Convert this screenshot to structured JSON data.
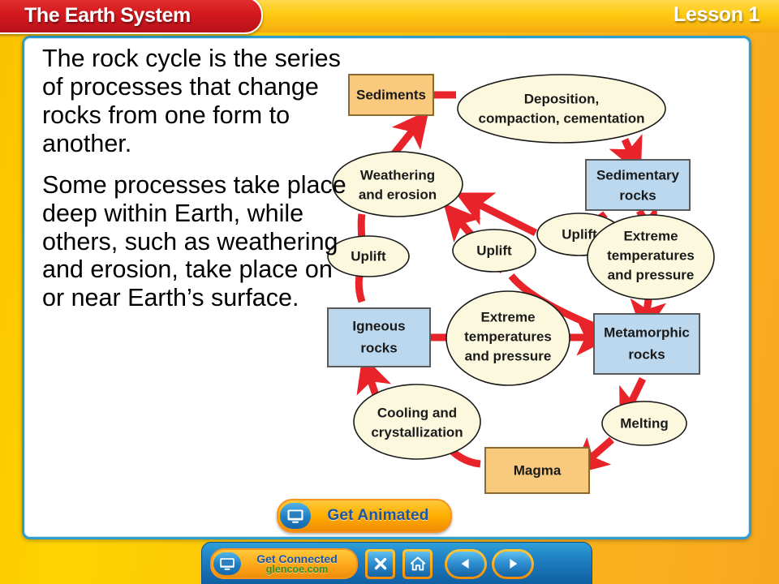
{
  "header": {
    "title": "The Earth System",
    "lesson": "Lesson 1"
  },
  "body": {
    "paragraph1": "The rock cycle is the series of processes that change rocks from one form to another.",
    "paragraph2": "Some processes take place deep within Earth, while others, such as weathering and erosion, take place on or near Earth’s surface."
  },
  "diagram": {
    "title": "Rock cycle diagram",
    "nodes": [
      {
        "id": "sediments",
        "label": "Sediments",
        "shape": "rect",
        "kind": "material",
        "color": "#f7c濃"
      },
      {
        "id": "deposition",
        "label": "Deposition, compaction, cementation",
        "shape": "ellipse",
        "kind": "process"
      },
      {
        "id": "sedimentary",
        "label": "Sedimentary rocks",
        "shape": "rect",
        "kind": "rock"
      },
      {
        "id": "weathering",
        "label": "Weathering and erosion",
        "shape": "ellipse",
        "kind": "process"
      },
      {
        "id": "uplift-left",
        "label": "Uplift",
        "shape": "ellipse",
        "kind": "process"
      },
      {
        "id": "uplift-mid",
        "label": "Uplift",
        "shape": "ellipse",
        "kind": "process"
      },
      {
        "id": "uplift-right",
        "label": "Uplift",
        "shape": "ellipse",
        "kind": "process"
      },
      {
        "id": "extreme-right",
        "label": "Extreme temperatures and pressure",
        "shape": "ellipse",
        "kind": "process"
      },
      {
        "id": "igneous",
        "label": "Igneous rocks",
        "shape": "rect",
        "kind": "rock"
      },
      {
        "id": "extreme-mid",
        "label": "Extreme temperatures and pressure",
        "shape": "ellipse",
        "kind": "process"
      },
      {
        "id": "metamorphic",
        "label": "Metamorphic rocks",
        "shape": "rect",
        "kind": "rock"
      },
      {
        "id": "cooling",
        "label": "Cooling and crystallization",
        "shape": "ellipse",
        "kind": "process"
      },
      {
        "id": "magma",
        "label": "Magma",
        "shape": "rect",
        "kind": "material"
      },
      {
        "id": "melting",
        "label": "Melting",
        "shape": "ellipse",
        "kind": "process"
      }
    ],
    "labels": {
      "sediments": "Sediments",
      "deposition_line1": "Deposition,",
      "deposition_line2": "compaction, cementation",
      "sedimentary_line1": "Sedimentary",
      "sedimentary_line2": "rocks",
      "weathering_line1": "Weathering",
      "weathering_line2": "and erosion",
      "uplift_left": "Uplift",
      "uplift_mid": "Uplift",
      "uplift_right": "Uplift",
      "extreme_right_line1": "Extreme",
      "extreme_right_line2": "temperatures",
      "extreme_right_line3": "and pressure",
      "igneous_line1": "Igneous",
      "igneous_line2": "rocks",
      "extreme_mid_line1": "Extreme",
      "extreme_mid_line2": "temperatures",
      "extreme_mid_line3": "and pressure",
      "metamorphic_line1": "Metamorphic",
      "metamorphic_line2": "rocks",
      "cooling_line1": "Cooling and",
      "cooling_line2": "crystallization",
      "magma": "Magma",
      "melting": "Melting"
    },
    "colors": {
      "material_fill": "#f9c97d",
      "material_stroke": "#8a6a2e",
      "rock_fill": "#bcd8ee",
      "rock_stroke": "#5a5a5a",
      "process_fill": "#fbf8de",
      "process_stroke": "#1a1a1a",
      "arrow": "#e8232a"
    }
  },
  "get_animated": {
    "label": "Get Animated",
    "icon": "monitor-icon"
  },
  "toolbar": {
    "get_connected_line1": "Get Connected",
    "get_connected_line2": "glencoe.com",
    "close_label": "Close",
    "home_label": "Home",
    "prev_label": "Previous",
    "next_label": "Next"
  },
  "theme": {
    "frame_yellow": "#ffc90f",
    "panel_border_blue": "#2e9ccc",
    "banner_red": "#d51a1f",
    "toolbar_blue": "#1f7fc2",
    "accent_orange": "#f7931e"
  }
}
